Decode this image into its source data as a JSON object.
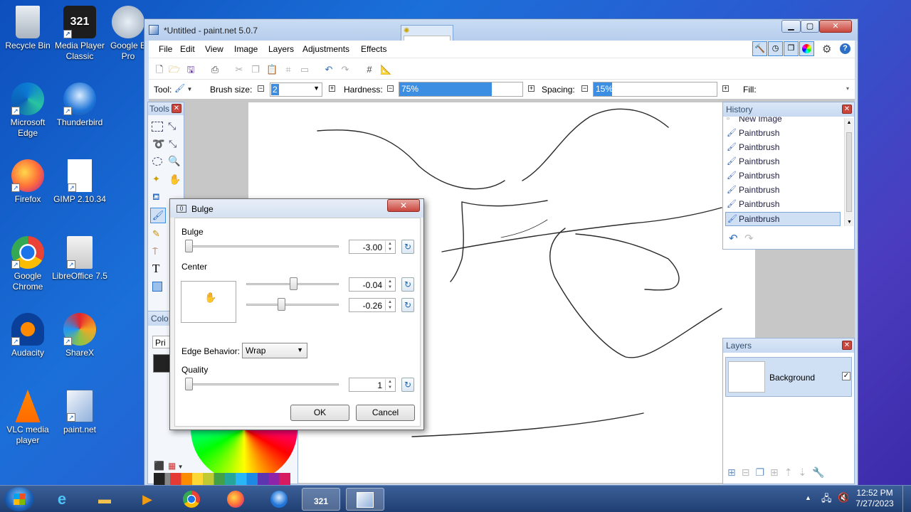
{
  "desktop": {
    "icons": [
      {
        "label": "Recycle Bin"
      },
      {
        "label": "Media Player Classic"
      },
      {
        "label": "Google E Pro"
      },
      {
        "label": "Microsoft Edge"
      },
      {
        "label": "Thunderbird"
      },
      {
        "label": "Firefox"
      },
      {
        "label": "GIMP 2.10.34"
      },
      {
        "label": "Google Chrome"
      },
      {
        "label": "LibreOffice 7.5"
      },
      {
        "label": "Audacity"
      },
      {
        "label": "ShareX"
      },
      {
        "label": "VLC media player"
      },
      {
        "label": "paint.net"
      }
    ]
  },
  "window": {
    "title": "*Untitled - paint.net 5.0.7",
    "menus": [
      "File",
      "Edit",
      "View",
      "Image",
      "Layers",
      "Adjustments",
      "Effects"
    ],
    "toolbar": {
      "tool_label": "Tool:",
      "brush_size_label": "Brush size:",
      "brush_size_value": "2",
      "hardness_label": "Hardness:",
      "hardness_value": "75%",
      "hardness_fraction": 0.75,
      "spacing_label": "Spacing:",
      "spacing_value": "15%",
      "spacing_fraction": 0.15,
      "fill_label": "Fill:"
    }
  },
  "tools_panel": {
    "title": "Tools"
  },
  "colors_panel": {
    "title": "Colo",
    "primary_label": "Pri"
  },
  "history_panel": {
    "title": "History",
    "items": [
      "New Image",
      "Paintbrush",
      "Paintbrush",
      "Paintbrush",
      "Paintbrush",
      "Paintbrush",
      "Paintbrush",
      "Paintbrush"
    ],
    "selected_index": 7
  },
  "layers_panel": {
    "title": "Layers",
    "layer_name": "Background",
    "visible": true
  },
  "dialog": {
    "title": "Bulge",
    "bulge_label": "Bulge",
    "bulge_value": "-3.00",
    "center_label": "Center",
    "center_x_value": "-0.04",
    "center_y_value": "-0.26",
    "edge_label": "Edge Behavior:",
    "edge_value": "Wrap",
    "quality_label": "Quality",
    "quality_value": "1",
    "ok_label": "OK",
    "cancel_label": "Cancel"
  },
  "taskbar": {
    "time": "12:52 PM",
    "date": "7/27/2023"
  },
  "colors": {
    "accent": "#3c8ee3",
    "selection": "#cfe0f5",
    "close_red": "#c9463d"
  }
}
